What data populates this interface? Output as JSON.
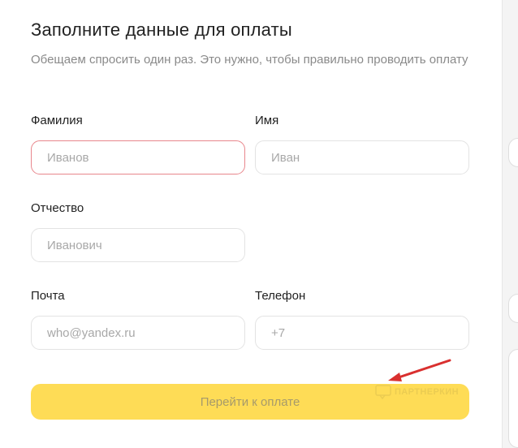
{
  "form": {
    "title": "Заполните данные для оплаты",
    "subtitle": "Обещаем спросить один раз. Это нужно, чтобы правильно проводить оплату",
    "fields": {
      "last_name": {
        "label": "Фамилия",
        "placeholder": "Иванов"
      },
      "first_name": {
        "label": "Имя",
        "placeholder": "Иван"
      },
      "middle_name": {
        "label": "Отчество",
        "placeholder": "Иванович"
      },
      "email": {
        "label": "Почта",
        "placeholder": "who@yandex.ru"
      },
      "phone": {
        "label": "Телефон",
        "placeholder": "+7"
      }
    },
    "submit_label": "Перейти к оплате"
  },
  "watermark": {
    "text": "ПАРТНЕРКИН"
  },
  "colors": {
    "button_bg": "#fedc56",
    "error_border": "#e8868c",
    "annotation_arrow": "#d9302f"
  }
}
